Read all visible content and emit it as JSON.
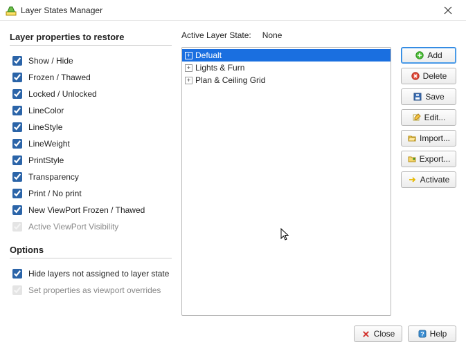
{
  "window": {
    "title": "Layer States Manager"
  },
  "left": {
    "heading_props": "Layer properties to restore",
    "props": [
      {
        "label": "Show / Hide",
        "checked": true,
        "enabled": true
      },
      {
        "label": "Frozen / Thawed",
        "checked": true,
        "enabled": true
      },
      {
        "label": "Locked / Unlocked",
        "checked": true,
        "enabled": true
      },
      {
        "label": "LineColor",
        "checked": true,
        "enabled": true
      },
      {
        "label": "LineStyle",
        "checked": true,
        "enabled": true
      },
      {
        "label": "LineWeight",
        "checked": true,
        "enabled": true
      },
      {
        "label": "PrintStyle",
        "checked": true,
        "enabled": true
      },
      {
        "label": "Transparency",
        "checked": true,
        "enabled": true
      },
      {
        "label": "Print / No print",
        "checked": true,
        "enabled": true
      },
      {
        "label": "New ViewPort Frozen / Thawed",
        "checked": true,
        "enabled": true
      },
      {
        "label": "Active ViewPort Visibility",
        "checked": true,
        "enabled": false
      }
    ],
    "heading_options": "Options",
    "options": [
      {
        "label": "Hide layers not assigned to layer state",
        "checked": true,
        "enabled": true
      },
      {
        "label": "Set properties as viewport overrides",
        "checked": true,
        "enabled": false
      }
    ]
  },
  "mid": {
    "active_label": "Active Layer State:",
    "active_value": "None",
    "tree": [
      {
        "label": "Defualt",
        "selected": true
      },
      {
        "label": "Lights & Furn",
        "selected": false
      },
      {
        "label": "Plan & Ceiling Grid",
        "selected": false
      }
    ]
  },
  "right": {
    "add": "Add",
    "delete": "Delete",
    "save": "Save",
    "edit": "Edit...",
    "import": "Import...",
    "export": "Export...",
    "activate": "Activate"
  },
  "footer": {
    "close": "Close",
    "help": "Help"
  }
}
